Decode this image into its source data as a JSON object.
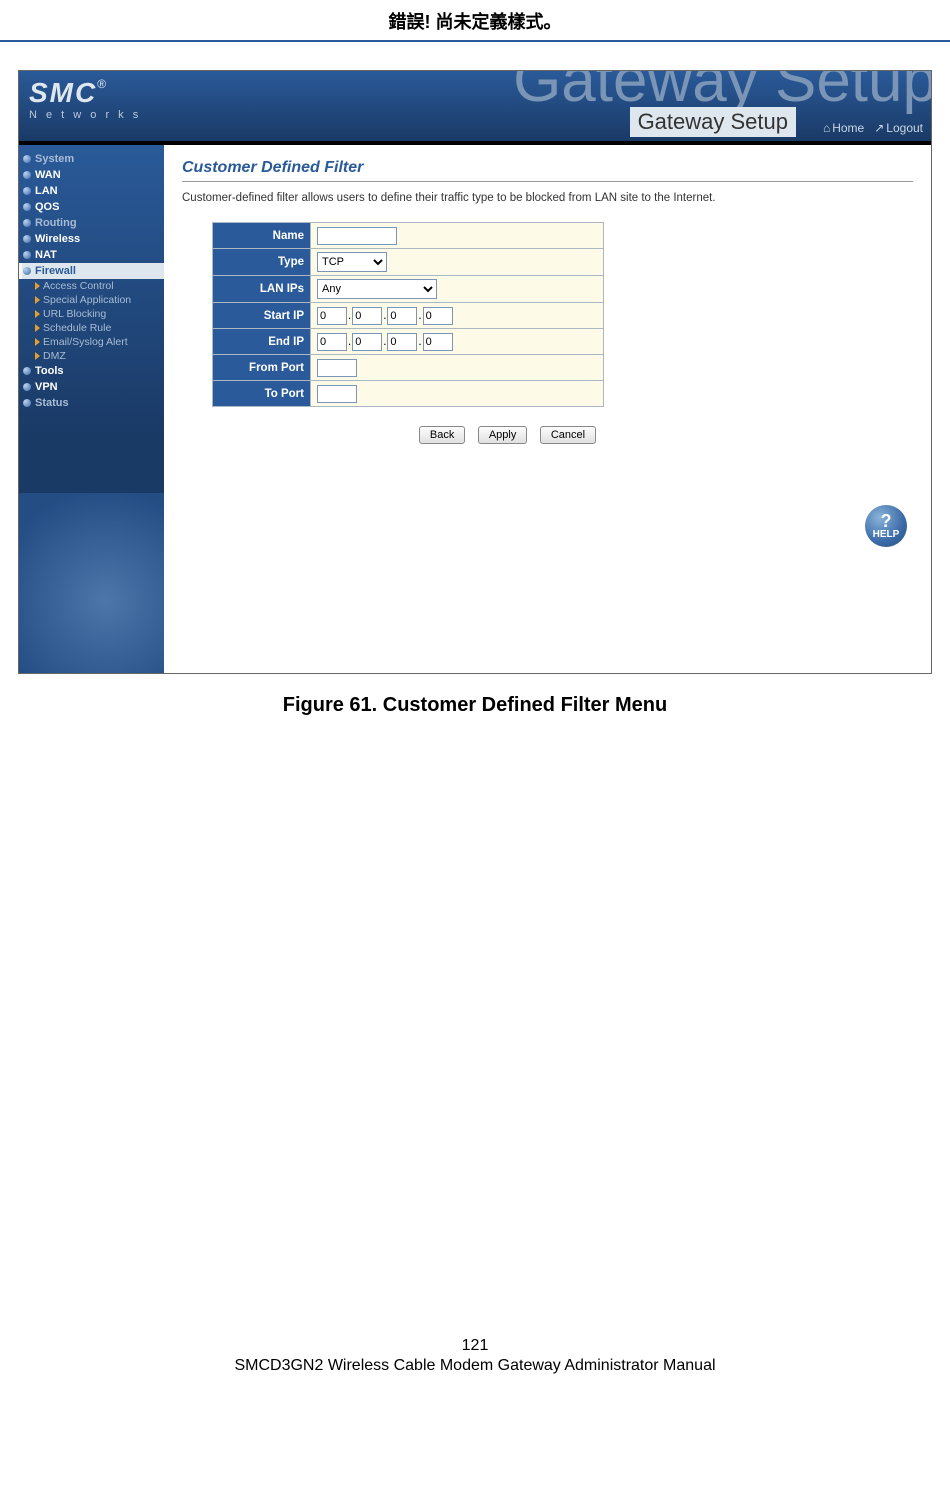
{
  "doc_header": "錯誤! 尚未定義樣式。",
  "header": {
    "ghost_title": "Gateway Setup",
    "title": "Gateway Setup",
    "home": "Home",
    "logout": "Logout",
    "logo_main": "SMC",
    "logo_reg": "®",
    "logo_sub": "N e t w o r k s"
  },
  "sidebar": {
    "system": "System",
    "wan": "WAN",
    "lan": "LAN",
    "qos": "QOS",
    "routing": "Routing",
    "wireless": "Wireless",
    "nat": "NAT",
    "firewall": "Firewall",
    "sub": {
      "access_control": "Access Control",
      "special_application": "Special Application",
      "url_blocking": "URL Blocking",
      "schedule_rule": "Schedule Rule",
      "email_syslog_alert": "Email/Syslog Alert",
      "dmz": "DMZ"
    },
    "tools": "Tools",
    "vpn": "VPN",
    "status": "Status"
  },
  "content": {
    "title": "Customer Defined Filter",
    "description": "Customer-defined filter allows users to define their traffic type to be blocked from LAN site to the Internet.",
    "form": {
      "name_label": "Name",
      "name_value": "",
      "type_label": "Type",
      "type_value": "TCP",
      "lanips_label": "LAN IPs",
      "lanips_value": "Any",
      "startip_label": "Start IP",
      "startip_values": [
        "0",
        "0",
        "0",
        "0"
      ],
      "endip_label": "End IP",
      "endip_values": [
        "0",
        "0",
        "0",
        "0"
      ],
      "fromport_label": "From Port",
      "fromport_value": "",
      "toport_label": "To Port",
      "toport_value": ""
    },
    "buttons": {
      "back": "Back",
      "apply": "Apply",
      "cancel": "Cancel"
    },
    "help": "HELP"
  },
  "figure_caption": "Figure 61. Customer Defined Filter Menu",
  "footer": {
    "page_number": "121",
    "manual_title": "SMCD3GN2 Wireless Cable Modem Gateway Administrator Manual"
  },
  "ip_sep": "."
}
